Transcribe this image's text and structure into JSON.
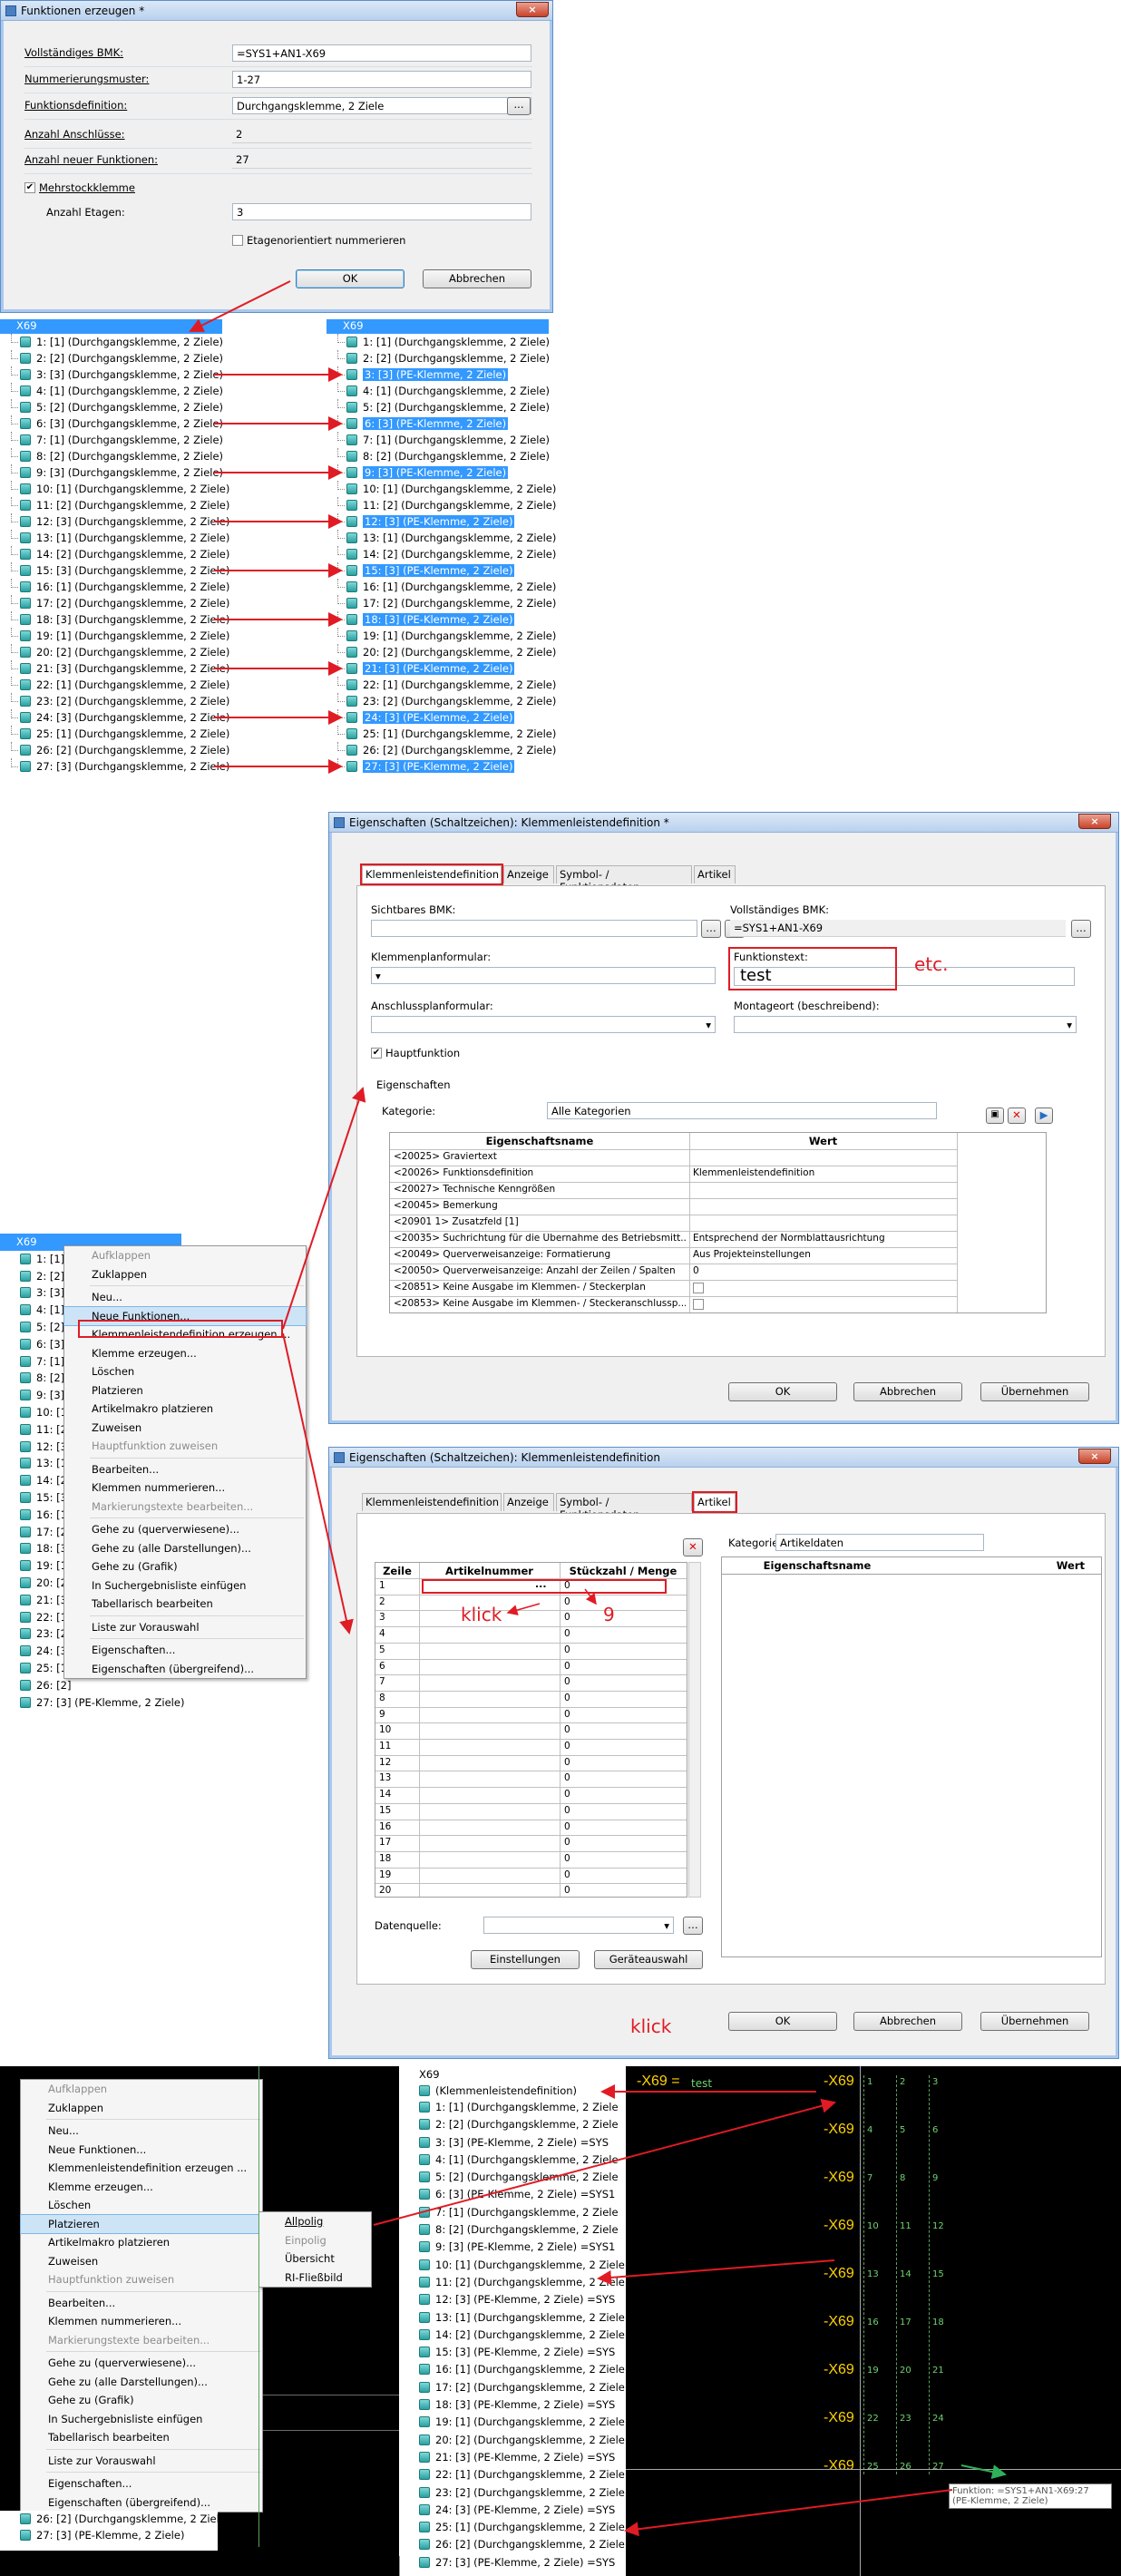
{
  "dialog1": {
    "title": "Funktionen erzeugen *",
    "close": "×",
    "fields": [
      {
        "label": "Vollständiges BMK:",
        "value": "=SYS1+AN1-X69"
      },
      {
        "label": "Nummerierungsmuster:",
        "value": "1-27"
      },
      {
        "label": "Funktionsdefinition:",
        "value": "Durchgangsklemme, 2 Ziele"
      },
      {
        "label": "Anzahl Anschlüsse:",
        "value": "2"
      },
      {
        "label": "Anzahl neuer Funktionen:",
        "value": "27"
      }
    ],
    "mehrstock_label": "Mehrstockklemme",
    "etagen_label": "Anzahl Etagen:",
    "etagen_value": "3",
    "etagen_orient": "Etagenorientiert nummerieren",
    "browse": "...",
    "ok": "OK",
    "cancel": "Abbrechen"
  },
  "tree_left": {
    "header": "X69",
    "rows": [
      "1: [1] (Durchgangsklemme, 2 Ziele)",
      "2: [2] (Durchgangsklemme, 2 Ziele)",
      "3: [3] (Durchgangsklemme, 2 Ziele)",
      "4: [1] (Durchgangsklemme, 2 Ziele)",
      "5: [2] (Durchgangsklemme, 2 Ziele)",
      "6: [3] (Durchgangsklemme, 2 Ziele)",
      "7: [1] (Durchgangsklemme, 2 Ziele)",
      "8: [2] (Durchgangsklemme, 2 Ziele)",
      "9: [3] (Durchgangsklemme, 2 Ziele)",
      "10: [1] (Durchgangsklemme, 2 Ziele)",
      "11: [2] (Durchgangsklemme, 2 Ziele)",
      "12: [3] (Durchgangsklemme, 2 Ziele)",
      "13: [1] (Durchgangsklemme, 2 Ziele)",
      "14: [2] (Durchgangsklemme, 2 Ziele)",
      "15: [3] (Durchgangsklemme, 2 Ziele)",
      "16: [1] (Durchgangsklemme, 2 Ziele)",
      "17: [2] (Durchgangsklemme, 2 Ziele)",
      "18: [3] (Durchgangsklemme, 2 Ziele)",
      "19: [1] (Durchgangsklemme, 2 Ziele)",
      "20: [2] (Durchgangsklemme, 2 Ziele)",
      "21: [3] (Durchgangsklemme, 2 Ziele)",
      "22: [1] (Durchgangsklemme, 2 Ziele)",
      "23: [2] (Durchgangsklemme, 2 Ziele)",
      "24: [3] (Durchgangsklemme, 2 Ziele)",
      "25: [1] (Durchgangsklemme, 2 Ziele)",
      "26: [2] (Durchgangsklemme, 2 Ziele)",
      "27: [3] (Durchgangsklemme, 2 Ziele)"
    ]
  },
  "tree_right": {
    "header": "X69",
    "rows": [
      "1: [1] (Durchgangsklemme, 2 Ziele)",
      "2: [2] (Durchgangsklemme, 2 Ziele)",
      "3: [3] (PE-Klemme, 2 Ziele)",
      "4: [1] (Durchgangsklemme, 2 Ziele)",
      "5: [2] (Durchgangsklemme, 2 Ziele)",
      "6: [3] (PE-Klemme, 2 Ziele)",
      "7: [1] (Durchgangsklemme, 2 Ziele)",
      "8: [2] (Durchgangsklemme, 2 Ziele)",
      "9: [3] (PE-Klemme, 2 Ziele)",
      "10: [1] (Durchgangsklemme, 2 Ziele)",
      "11: [2] (Durchgangsklemme, 2 Ziele)",
      "12: [3] (PE-Klemme, 2 Ziele)",
      "13: [1] (Durchgangsklemme, 2 Ziele)",
      "14: [2] (Durchgangsklemme, 2 Ziele)",
      "15: [3] (PE-Klemme, 2 Ziele)",
      "16: [1] (Durchgangsklemme, 2 Ziele)",
      "17: [2] (Durchgangsklemme, 2 Ziele)",
      "18: [3] (PE-Klemme, 2 Ziele)",
      "19: [1] (Durchgangsklemme, 2 Ziele)",
      "20: [2] (Durchgangsklemme, 2 Ziele)",
      "21: [3] (PE-Klemme, 2 Ziele)",
      "22: [1] (Durchgangsklemme, 2 Ziele)",
      "23: [2] (Durchgangsklemme, 2 Ziele)",
      "24: [3] (PE-Klemme, 2 Ziele)",
      "25: [1] (Durchgangsklemme, 2 Ziele)",
      "26: [2] (Durchgangsklemme, 2 Ziele)",
      "27: [3] (PE-Klemme, 2 Ziele)"
    ]
  },
  "dialog2": {
    "title": "Eigenschaften (Schaltzeichen): Klemmenleistendefinition *",
    "close": "×",
    "tabs": [
      "Klemmenleistendefinition",
      "Anzeige",
      "Symbol- / Funktionsdaten",
      "Artikel"
    ],
    "sichtbares_bmk": "Sichtbares BMK:",
    "vollst_bmk": "Vollständiges BMK:",
    "vollst_bmk_value": "=SYS1+AN1-X69",
    "klemmenplan": "Klemmenplanformular:",
    "funktionstext": "Funktionstext:",
    "funktionstext_value": "test",
    "etc": "etc.",
    "anschluss": "Anschlussplanformular:",
    "montageort": "Montageort (beschreibend):",
    "hauptfunktion": "Hauptfunktion",
    "eigenschaften": "Eigenschaften",
    "kategorie": "Kategorie:",
    "kategorie_value": "Alle Kategorien",
    "col_name": "Eigenschaftsname",
    "col_wert": "Wert",
    "rows": [
      [
        "<20025> Graviertext",
        ""
      ],
      [
        "<20026> Funktionsdefinition",
        "Klemmenleistendefinition"
      ],
      [
        "<20027> Technische Kenngrößen",
        ""
      ],
      [
        "<20045> Bemerkung",
        ""
      ],
      [
        "<20901 1> Zusatzfeld [1]",
        ""
      ],
      [
        "<20035> Suchrichtung für die Übernahme des Betriebsmitt...",
        "Entsprechend der Normblattausrichtung"
      ],
      [
        "<20049> Querverweisanzeige: Formatierung",
        "Aus Projekteinstellungen"
      ],
      [
        "<20050> Querverweisanzeige: Anzahl der Zeilen / Spalten",
        "0"
      ],
      [
        "<20851> Keine Ausgabe im Klemmen- / Steckerplan",
        ""
      ],
      [
        "<20853> Keine Ausgabe im Klemmen- / Steckeranschlussp...",
        ""
      ]
    ],
    "ok": "OK",
    "cancel": "Abbrechen",
    "apply": "Übernehmen"
  },
  "dialog3": {
    "title": "Eigenschaften (Schaltzeichen): Klemmenleistendefinition",
    "close": "×",
    "tabs": [
      "Klemmenleistendefinition",
      "Anzeige",
      "Symbol- / Funktionsdaten",
      "Artikel"
    ],
    "col_zeile": "Zeile",
    "col_art": "Artikelnummer",
    "col_menge": "Stückzahl / Menge",
    "row_nums": [
      "1",
      "2",
      "3",
      "4",
      "5",
      "6",
      "7",
      "8",
      "9",
      "10",
      "11",
      "12",
      "13",
      "14",
      "15",
      "16",
      "17",
      "18",
      "19",
      "20"
    ],
    "menge": [
      "0",
      "0",
      "0",
      "0",
      "0",
      "0",
      "0",
      "0",
      "0",
      "0",
      "0",
      "0",
      "0",
      "0",
      "0",
      "0",
      "0",
      "0",
      "0",
      "0"
    ],
    "dots": "...",
    "klick": "klick",
    "nine": "9",
    "kategorie": "Kategorie:",
    "kategorie_value": "Artikeldaten",
    "col_name": "Eigenschaftsname",
    "col_wert": "Wert",
    "datenquelle": "Datenquelle:",
    "einstellungen": "Einstellungen",
    "geraeteauswahl": "Geräteauswahl",
    "klick2": "klick",
    "ok": "OK",
    "cancel": "Abbrechen",
    "apply": "Übernehmen"
  },
  "menu1": {
    "items": [
      "Aufklappen",
      "Zuklappen",
      "",
      "Neu...",
      "Neue Funktionen...",
      "Klemmenleistendefinition erzeugen ...",
      "Klemme erzeugen...",
      "Löschen",
      "Platzieren",
      "Artikelmakro platzieren",
      "Zuweisen",
      "Hauptfunktion zuweisen",
      "",
      "Bearbeiten...",
      "Klemmen nummerieren...",
      "Markierungstexte bearbeiten...",
      "",
      "Gehe zu (querverwiesene)...",
      "Gehe zu (alle Darstellungen)...",
      "Gehe zu (Grafik)",
      "In Suchergebnisliste einfügen",
      "Tabellarisch bearbeiten",
      "",
      "Liste zur Vorauswahl",
      "",
      "Eigenschaften...",
      "Eigenschaften (übergreifend)..."
    ],
    "tree_rows": [
      "X69",
      "1: [1] (",
      "2: [2] (",
      "3: [3] (",
      "4: [1] (",
      "5: [2] (",
      "6: [3] (",
      "7: [1] (",
      "8: [2] (",
      "9: [3] (",
      "10: [1]",
      "11: [2]",
      "12: [3]",
      "13: [1]",
      "14: [2]",
      "15: [3]",
      "16: [1]",
      "17: [2]",
      "18: [3]",
      "19: [1]",
      "20: [2]",
      "21: [3]",
      "22: [1]",
      "23: [2]",
      "24: [3]",
      "25: [1]",
      "26: [2]"
    ],
    "tree_last": "27: [3] (PE-Klemme, 2 Ziele)"
  },
  "menu2": {
    "items": [
      "Aufklappen",
      "Zuklappen",
      "",
      "Neu...",
      "Neue Funktionen...",
      "Klemmenleistendefinition erzeugen ...",
      "Klemme erzeugen...",
      "Löschen",
      "Platzieren",
      "Artikelmakro platzieren",
      "Zuweisen",
      "Hauptfunktion zuweisen",
      "",
      "Bearbeiten...",
      "Klemmen nummerieren...",
      "Markierungstexte bearbeiten...",
      "",
      "Gehe zu (querverwiesene)...",
      "Gehe zu (alle Darstellungen)...",
      "Gehe zu (Grafik)",
      "In Suchergebnisliste einfügen",
      "Tabellarisch bearbeiten",
      "",
      "Liste zur Vorauswahl",
      "",
      "Eigenschaften...",
      "Eigenschaften (übergreifend)..."
    ],
    "submenu": [
      "Allpolig",
      "Einpolig",
      "Übersicht",
      "RI-Fließbild"
    ],
    "tree_last": [
      "26: [2] (Durchgangsklemme, 2 Ziele)",
      "27: [3] (PE-Klemme, 2 Ziele)"
    ]
  },
  "tree3": {
    "header": "X69",
    "def": "(Klemmenleistendefinition)",
    "rows": [
      "1: [1] (Durchgangsklemme, 2 Ziele",
      "2: [2] (Durchgangsklemme, 2 Ziele",
      "3: [3] (PE-Klemme, 2 Ziele) =SYS",
      "4: [1] (Durchgangsklemme, 2 Ziele",
      "5: [2] (Durchgangsklemme, 2 Ziele",
      "6: [3] (PE-Klemme, 2 Ziele) =SYS1",
      "7: [1] (Durchgangsklemme, 2 Ziele",
      "8: [2] (Durchgangsklemme, 2 Ziele",
      "9: [3] (PE-Klemme, 2 Ziele) =SYS1",
      "10: [1] (Durchgangsklemme, 2 Ziele",
      "11: [2] (Durchgangsklemme, 2 Ziele",
      "12: [3] (PE-Klemme, 2 Ziele) =SYS",
      "13: [1] (Durchgangsklemme, 2 Ziele",
      "14: [2] (Durchgangsklemme, 2 Ziele",
      "15: [3] (PE-Klemme, 2 Ziele) =SYS",
      "16: [1] (Durchgangsklemme, 2 Ziele",
      "17: [2] (Durchgangsklemme, 2 Ziele",
      "18: [3] (PE-Klemme, 2 Ziele) =SYS",
      "19: [1] (Durchgangsklemme, 2 Ziele",
      "20: [2] (Durchgangsklemme, 2 Ziele",
      "21: [3] (PE-Klemme, 2 Ziele) =SYS",
      "22: [1] (Durchgangsklemme, 2 Ziele",
      "23: [2] (Durchgangsklemme, 2 Ziele",
      "24: [3] (PE-Klemme, 2 Ziele) =SYS",
      "25: [1] (Durchgangsklemme, 2 Ziele",
      "26: [2] (Durchgangsklemme, 2 Ziele",
      "27: [3] (PE-Klemme, 2 Ziele) =SYS"
    ]
  },
  "cad": {
    "title": "-X69 =",
    "test": "test",
    "labels": [
      "-X69",
      "-X69",
      "-X69",
      "-X69",
      "-X69",
      "-X69",
      "-X69",
      "-X69",
      "-X69"
    ],
    "nums": [
      [
        "1",
        "2",
        "3"
      ],
      [
        "4",
        "5",
        "6"
      ],
      [
        "7",
        "8",
        "9"
      ],
      [
        "10",
        "11",
        "12"
      ],
      [
        "13",
        "14",
        "15"
      ],
      [
        "16",
        "17",
        "18"
      ],
      [
        "19",
        "20",
        "21"
      ],
      [
        "22",
        "23",
        "24"
      ],
      [
        "25",
        "26",
        "27"
      ]
    ],
    "tooltip1": "Funktion: =SYS1+AN1-X69:27",
    "tooltip2": "(PE-Klemme, 2 Ziele)"
  },
  "colors": {
    "accent": "#3399ff",
    "annotation": "#e01b24",
    "cad_text": "#ffd200"
  }
}
